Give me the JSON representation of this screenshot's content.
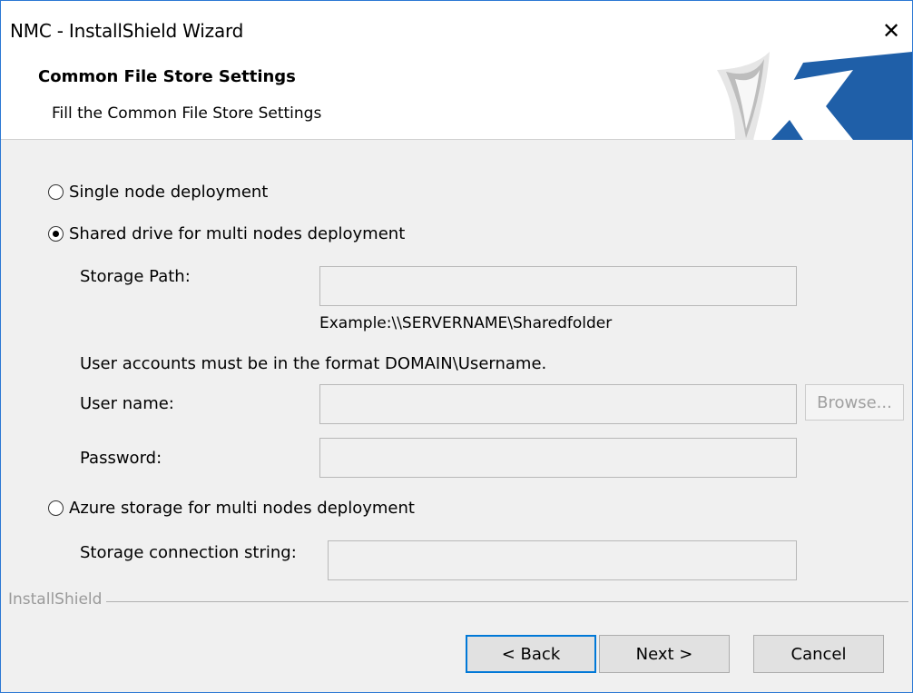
{
  "window": {
    "title": "NMC - InstallShield Wizard",
    "close_glyph": "✕"
  },
  "header": {
    "title": "Common File Store Settings",
    "subtitle": "Fill the Common File Store Settings"
  },
  "options": {
    "single": {
      "label": "Single node deployment",
      "selected": false
    },
    "shared": {
      "label": "Shared drive for multi nodes deployment",
      "selected": true
    },
    "azure": {
      "label": "Azure storage for multi nodes deployment",
      "selected": false
    }
  },
  "shared": {
    "storage_path_label": "Storage Path:",
    "storage_path_value": "",
    "example": "Example:\\\\SERVERNAME\\Sharedfolder",
    "accounts_note": "User accounts must be in the format DOMAIN\\Username.",
    "username_label": "User name:",
    "username_value": "",
    "browse_label": "Browse...",
    "password_label": "Password:",
    "password_value": ""
  },
  "azure": {
    "connection_label": "Storage connection string:",
    "connection_value": ""
  },
  "footer": {
    "installshield": "InstallShield",
    "back": "< Back",
    "next": "Next >",
    "cancel": "Cancel"
  },
  "colors": {
    "accent": "#0078d7",
    "logo_blue": "#1f5fa8",
    "window_border": "#2b78d4"
  }
}
